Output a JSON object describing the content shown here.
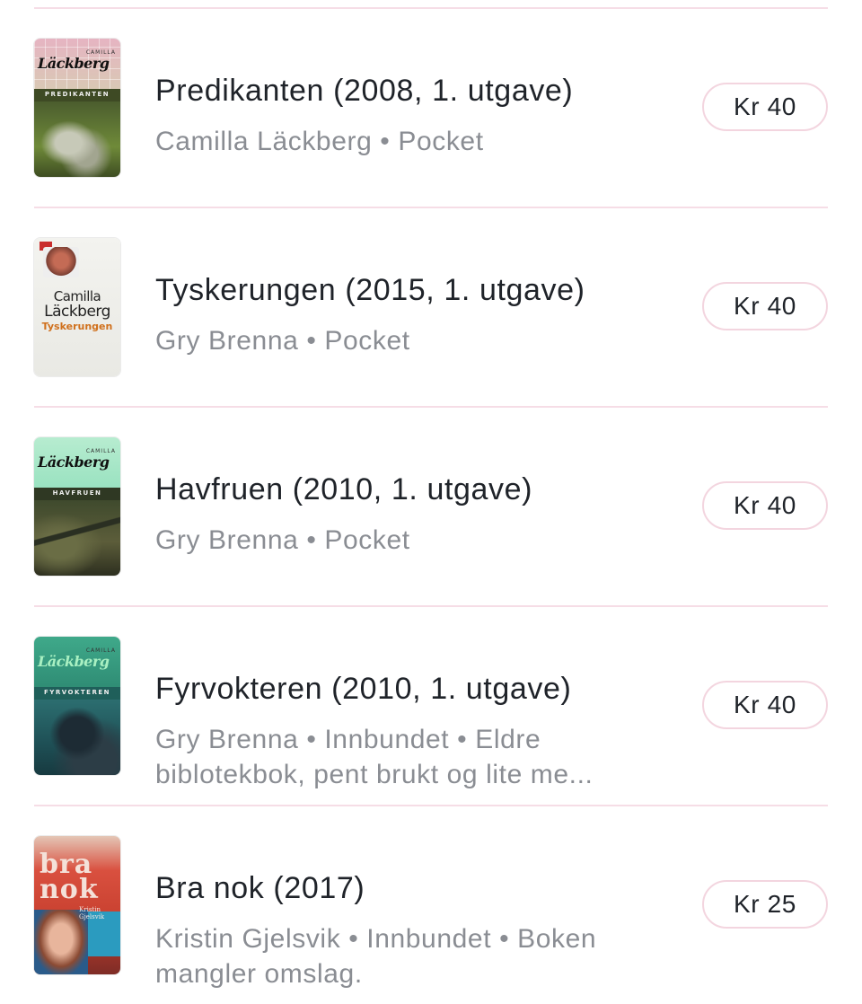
{
  "listings": [
    {
      "title": "Predikanten (2008, 1. utgave)",
      "meta": "Camilla Läckberg • Pocket",
      "price": "Kr 40",
      "cover": {
        "author": "Läckberg",
        "small": "CAMILLA",
        "title": "PREDIKANTEN"
      }
    },
    {
      "title": "Tyskerungen (2015, 1. utgave)",
      "meta": "Gry Brenna • Pocket",
      "price": "Kr 40",
      "cover": {
        "line1": "Camilla",
        "line2": "Läckberg",
        "title": "Tyskerungen"
      }
    },
    {
      "title": "Havfruen (2010, 1. utgave)",
      "meta": "Gry Brenna • Pocket",
      "price": "Kr 40",
      "cover": {
        "author": "Läckberg",
        "small": "CAMILLA",
        "title": "HAVFRUEN"
      }
    },
    {
      "title": "Fyrvokteren (2010, 1. utgave)",
      "meta": "Gry Brenna • Innbundet • Eldre biblotekbok, pent brukt og lite me...",
      "price": "Kr 40",
      "cover": {
        "author": "Läckberg",
        "small": "CAMILLA",
        "title": "FYRVOKTEREN"
      }
    },
    {
      "title": "Bra nok (2017)",
      "meta": "Kristin Gjelsvik • Innbundet • Boken mangler omslag.",
      "price": "Kr 25",
      "cover": {
        "line1": "bra",
        "line2": "nok",
        "author": "Kristin Gjelsvik"
      }
    }
  ]
}
